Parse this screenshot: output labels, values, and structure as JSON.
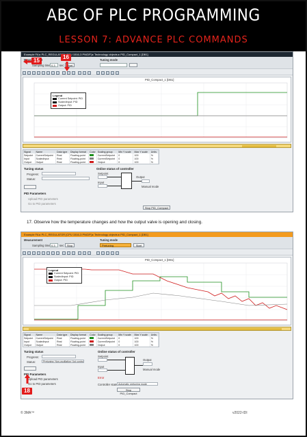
{
  "header": {
    "title": "ABC OF PLC PROGRAMMING",
    "subtitle": "LESSON 7: ADVANCE PLC COMMANDS"
  },
  "screenshot1": {
    "breadcrumb": "Example FA ▸ PLC_REGULATOR [CPU 1516-3 PN/DP] ▸ Technology objects ▸ PID_Compact_1 [DB1]",
    "measurement_label": "Measurement",
    "sampling_time_label": "Sampling time",
    "sampling_time_value": "0.3",
    "sampling_unit": "sec",
    "start_button": "Start",
    "tuning_mode_label": "Tuning mode",
    "chart_title": "PID_Compact_1 [DB1]",
    "legend": {
      "title": "Legend",
      "items": [
        "Current Setpoint: PID",
        "ScaledInput: PID",
        "Output: PID"
      ],
      "colors": [
        "#1b8f1b",
        "#808080",
        "#d01c1c"
      ]
    },
    "table_headers": [
      "Signal",
      "Name",
      "Data type",
      "Display format",
      "Color",
      "Scaling group",
      "Min Y scale",
      "Max Y scale",
      "Units"
    ],
    "table_rows": [
      [
        "Setpoint",
        "CurrentSetpoint",
        "Real",
        "Floating-point",
        "",
        "CurrentSetpoint",
        "0",
        "100",
        "%"
      ],
      [
        "Input",
        "ScaledInput",
        "Real",
        "Floating-point",
        "",
        "CurrentSetpoint",
        "0",
        "100",
        "%"
      ],
      [
        "Output",
        "Output",
        "Real",
        "Floating-point",
        "",
        "Output",
        "0",
        "100",
        "%"
      ]
    ],
    "tuning_status_label": "Tuning status",
    "progress_label": "Progress:",
    "status_label": "Status:",
    "online_status_label": "Online status of controller",
    "setpoint_label": "Setpoint",
    "input_label": "Input",
    "output_label": "Output",
    "manual_mode_label": "Manual mode",
    "upload_pid_button": "Upload PID parameters",
    "pid_parameters_label": "PID Parameters",
    "send_pid_label": "Upload PID parameters",
    "go_online_label": "Go to PID parameters",
    "stop_pid_button": "Stop PID_Compact",
    "markers": [
      "15",
      "16"
    ]
  },
  "instruction": "17.  Observe how the temperature changes and how the output valve is opening and closing.",
  "screenshot2": {
    "breadcrumb": "Example FA ▸ PLC_REGULATOR [CPU 1516-3 PN/DP] ▸ Technology objects ▸ PID_Compact_1 [DB1]",
    "measurement_label": "Measurement",
    "sampling_time_label": "Sampling time",
    "sampling_time_value": "0.3",
    "sampling_unit": "sec",
    "stop_button": "Stop",
    "tuning_mode_label": "Tuning mode",
    "tuning_mode_value": "Pretuning",
    "start_button": "Start",
    "chart_title": "PID_Compact_1 [DB1]",
    "legend": {
      "title": "Legend",
      "items": [
        "Current Setpoint: PID",
        "ScaledInput: PID",
        "Output: PID"
      ],
      "colors": [
        "#1b8f1b",
        "#d01c1c",
        "#808080"
      ]
    },
    "table_headers": [
      "Signal",
      "Name",
      "Data type",
      "Display format",
      "Color",
      "Scaling group",
      "Min Y scale",
      "Max Y scale",
      "Units"
    ],
    "table_rows": [
      [
        "Setpoint",
        "CurrentSetpoint",
        "Real",
        "Floating-point",
        "",
        "CurrentSetpoint",
        "0",
        "100",
        "%"
      ],
      [
        "Input",
        "ScaledInput",
        "Real",
        "Floating-point",
        "",
        "CurrentSetpoint",
        "0",
        "100",
        "%"
      ],
      [
        "Output",
        "Output",
        "Real",
        "Floating-point",
        "",
        "Output",
        "0",
        "100",
        "%"
      ]
    ],
    "tuning_status_label": "Tuning status",
    "progress_label": "Progress:",
    "status_label": "Status:",
    "status_value": "Pretuning: Non-oscillation (1st controller)",
    "online_status_label": "Online status of controller",
    "setpoint_label": "Setpoint",
    "input_label": "Input",
    "output_label": "Output",
    "manual_mode_label": "Manual mode",
    "error_label": "Error",
    "controller_state_label": "Controller state:",
    "controller_state_value": "Automatic pretuning mode",
    "stop_pid_button": "Stop PID_Compact",
    "pid_parameters_label": "PID Parameters",
    "upload_pid_label": "Upload PID parameters",
    "go_pid_label": "Go to PID parameters",
    "marker": "18"
  },
  "footer": {
    "left": "© 3MA™",
    "right": "v2022-IDI"
  }
}
